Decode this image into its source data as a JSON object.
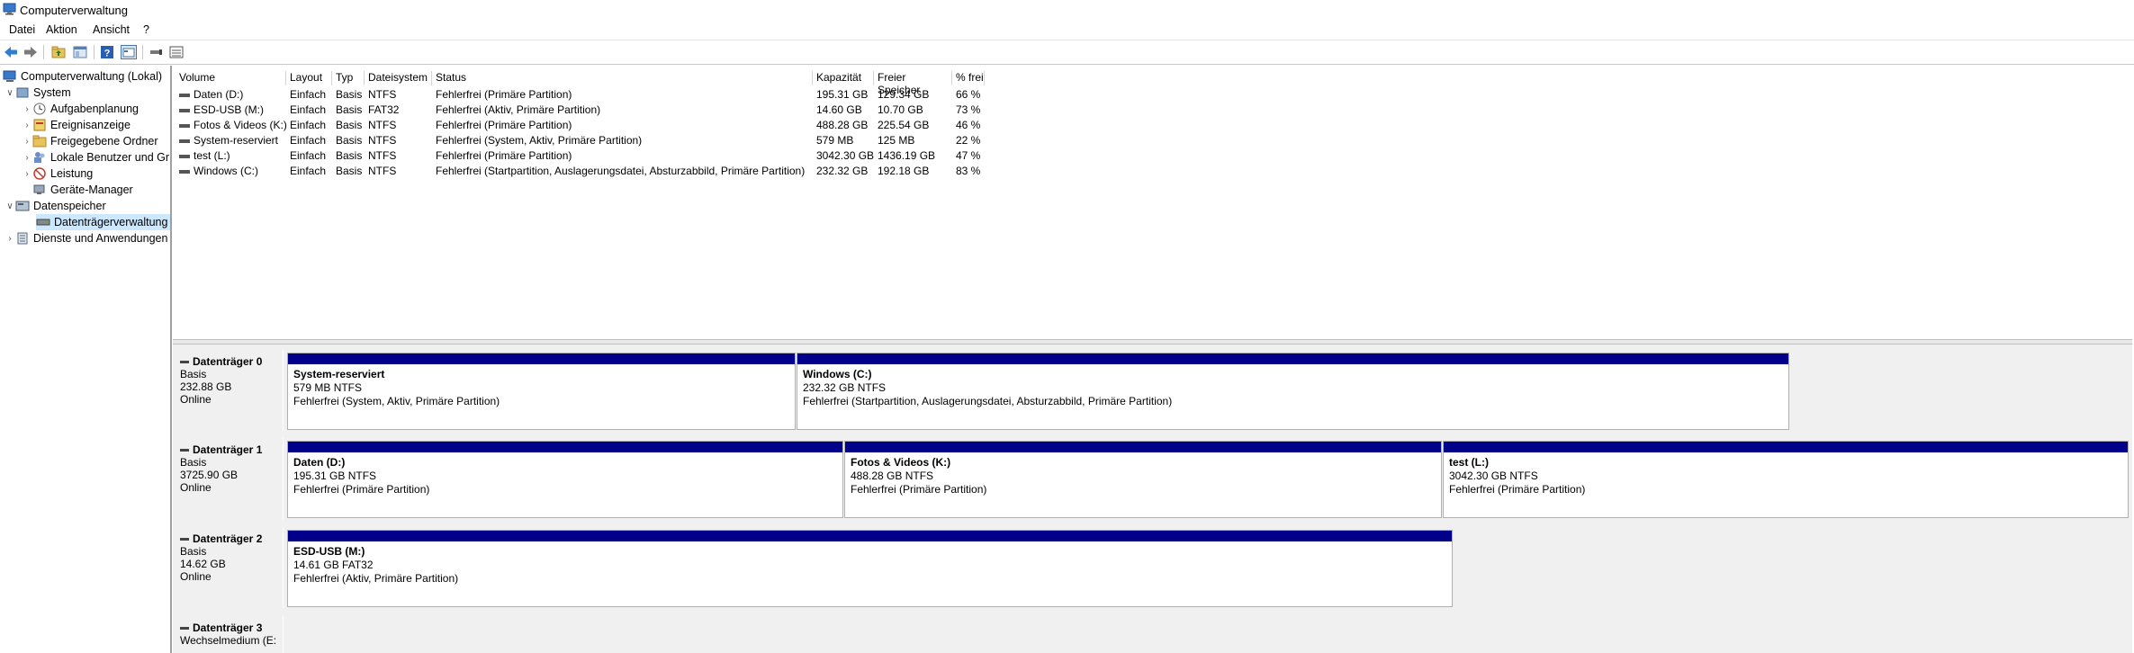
{
  "window": {
    "title": "Computerverwaltung"
  },
  "menu": [
    "Datei",
    "Aktion",
    "Ansicht",
    "?"
  ],
  "toolbar": {
    "icons": [
      "back-arrow-icon",
      "forward-arrow-icon",
      "up-folder-icon",
      "show-hide-tree-icon",
      "help-icon",
      "properties-icon",
      "connect-icon",
      "view-icon"
    ]
  },
  "tree": {
    "root": "Computerverwaltung (Lokal)",
    "system": "System",
    "aufgaben": "Aufgabenplanung",
    "ereignis": "Ereignisanzeige",
    "freigegeben": "Freigegebene Ordner",
    "lokale": "Lokale Benutzer und Gr",
    "leistung": "Leistung",
    "geraete": "Geräte-Manager",
    "datenspeicher": "Datenspeicher",
    "datentraeger": "Datenträgerverwaltung",
    "dienste": "Dienste und Anwendungen"
  },
  "volumes": {
    "headers": [
      "Volume",
      "Layout",
      "Typ",
      "Dateisystem",
      "Status",
      "Kapazität",
      "Freier Speicher",
      "% frei"
    ],
    "rows": [
      [
        "Daten (D:)",
        "Einfach",
        "Basis",
        "NTFS",
        "Fehlerfrei (Primäre Partition)",
        "195.31 GB",
        "129.34 GB",
        "66 %"
      ],
      [
        "ESD-USB (M:)",
        "Einfach",
        "Basis",
        "FAT32",
        "Fehlerfrei (Aktiv, Primäre Partition)",
        "14.60 GB",
        "10.70 GB",
        "73 %"
      ],
      [
        "Fotos & Videos (K:)",
        "Einfach",
        "Basis",
        "NTFS",
        "Fehlerfrei (Primäre Partition)",
        "488.28 GB",
        "225.54 GB",
        "46 %"
      ],
      [
        "System-reserviert",
        "Einfach",
        "Basis",
        "NTFS",
        "Fehlerfrei (System, Aktiv, Primäre Partition)",
        "579 MB",
        "125 MB",
        "22 %"
      ],
      [
        "test (L:)",
        "Einfach",
        "Basis",
        "NTFS",
        "Fehlerfrei (Primäre Partition)",
        "3042.30 GB",
        "1436.19 GB",
        "47 %"
      ],
      [
        "Windows (C:)",
        "Einfach",
        "Basis",
        "NTFS",
        "Fehlerfrei (Startpartition, Auslagerungsdatei, Absturzabbild, Primäre Partition)",
        "232.32 GB",
        "192.18 GB",
        "83 %"
      ]
    ]
  },
  "disks": [
    {
      "name": "Datenträger 0",
      "type": "Basis",
      "size": "232.88 GB",
      "state": "Online",
      "partitions": [
        {
          "name": "System-reserviert",
          "size": "579 MB NTFS",
          "status": "Fehlerfrei (System, Aktiv, Primäre Partition)"
        },
        {
          "name": "Windows  (C:)",
          "size": "232.32 GB NTFS",
          "status": "Fehlerfrei (Startpartition, Auslagerungsdatei, Absturzabbild, Primäre Partition)"
        }
      ]
    },
    {
      "name": "Datenträger 1",
      "type": "Basis",
      "size": "3725.90 GB",
      "state": "Online",
      "partitions": [
        {
          "name": "Daten  (D:)",
          "size": "195.31 GB NTFS",
          "status": "Fehlerfrei (Primäre Partition)"
        },
        {
          "name": "Fotos & Videos  (K:)",
          "size": "488.28 GB NTFS",
          "status": "Fehlerfrei (Primäre Partition)"
        },
        {
          "name": "test  (L:)",
          "size": "3042.30 GB NTFS",
          "status": "Fehlerfrei (Primäre Partition)"
        }
      ]
    },
    {
      "name": "Datenträger 2",
      "type": "Basis",
      "size": "14.62 GB",
      "state": "Online",
      "partitions": [
        {
          "name": "ESD-USB  (M:)",
          "size": "14.61 GB FAT32",
          "status": "Fehlerfrei (Aktiv, Primäre Partition)"
        }
      ]
    },
    {
      "name": "Datenträger 3",
      "type": "Wechselmedium (E:",
      "size": "",
      "state": "",
      "partitions": []
    }
  ],
  "colors": {
    "partition_bar": "#00008b",
    "selection": "#cce8ff"
  }
}
